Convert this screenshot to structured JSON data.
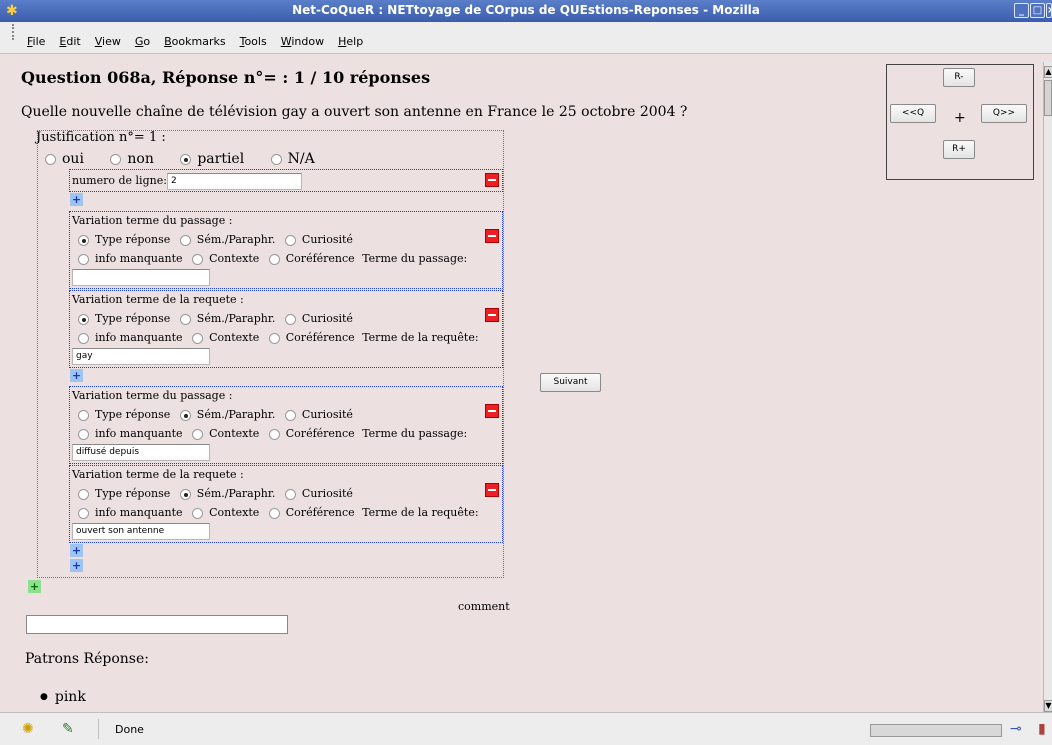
{
  "window": {
    "title": "Net-CoQueR : NETtoyage de COrpus de QUEstions-Reponses - Mozilla",
    "controls": [
      "_",
      "□",
      "×"
    ]
  },
  "menu": [
    "File",
    "Edit",
    "View",
    "Go",
    "Bookmarks",
    "Tools",
    "Window",
    "Help"
  ],
  "question": {
    "title": "Question 068a, Réponse n°= : 1 / 10 réponses",
    "text": "Quelle nouvelle chaîne de télévision gay a ouvert son antenne en France le 25 octobre 2004 ?"
  },
  "nav": {
    "r_minus": "R-",
    "prev_q": "<<Q",
    "plus": "+",
    "next_q": "Q>>",
    "r_plus": "R+"
  },
  "justification": {
    "label": "Justification n°= 1 :",
    "status_options": [
      "oui",
      "non",
      "partiel",
      "N/A"
    ],
    "status_selected": "partiel",
    "line_label": "numero de ligne:",
    "line_value": "2",
    "variations": [
      {
        "header": "Variation terme du passage :",
        "opt_row1": [
          "Type réponse",
          "Sém./Paraphr.",
          "Curiosité"
        ],
        "opt_row2": [
          "info manquante",
          "Contexte",
          "Coréférence"
        ],
        "term_label": "Terme du passage:",
        "selected": "Type réponse",
        "value": ""
      },
      {
        "header": "Variation terme de la requete :",
        "opt_row1": [
          "Type réponse",
          "Sém./Paraphr.",
          "Curiosité"
        ],
        "opt_row2": [
          "info manquante",
          "Contexte",
          "Coréférence"
        ],
        "term_label": "Terme de la requête:",
        "selected": "Type réponse",
        "value": "gay"
      },
      {
        "header": "Variation terme du passage :",
        "opt_row1": [
          "Type réponse",
          "Sém./Paraphr.",
          "Curiosité"
        ],
        "opt_row2": [
          "info manquante",
          "Contexte",
          "Coréférence"
        ],
        "term_label": "Terme du passage:",
        "selected": "Sém./Paraphr.",
        "value": "diffusé depuis"
      },
      {
        "header": "Variation terme de la requete :",
        "opt_row1": [
          "Type réponse",
          "Sém./Paraphr.",
          "Curiosité"
        ],
        "opt_row2": [
          "info manquante",
          "Contexte",
          "Coréférence"
        ],
        "term_label": "Terme de la requête:",
        "selected": "Sém./Paraphr.",
        "value": "ouvert son antenne"
      }
    ]
  },
  "suivant_label": "Suivant",
  "comment_label": "comment",
  "comment_value": "",
  "patrons_label": "Patrons Réponse:",
  "patrons": [
    "pink"
  ],
  "status": {
    "text": "Done"
  }
}
